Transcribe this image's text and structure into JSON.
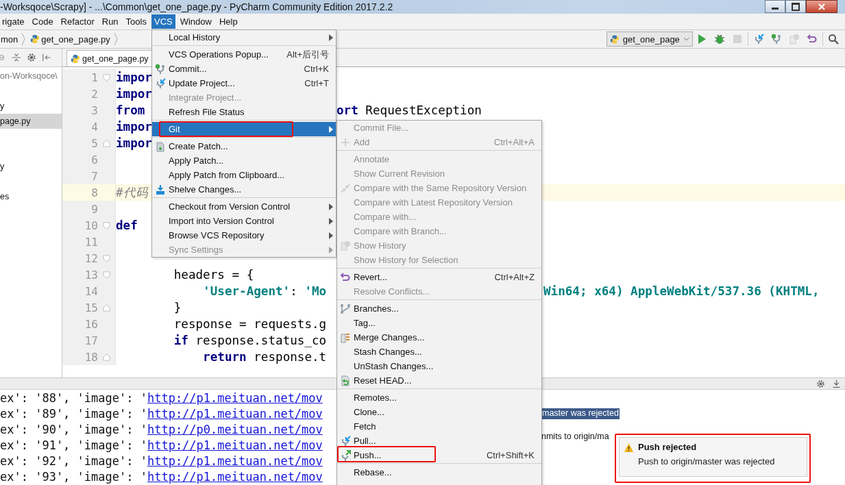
{
  "window": {
    "title": "-Worksqoce\\Scrapy] - ...\\Common\\get_one_page.py - PyCharm Community Edition 2017.2.2"
  },
  "menu_bar": [
    {
      "label": "rigate",
      "selected": false
    },
    {
      "label": "Code",
      "selected": false
    },
    {
      "label": "Refactor",
      "selected": false
    },
    {
      "label": "Run",
      "selected": false
    },
    {
      "label": "Tools",
      "selected": false
    },
    {
      "label": "VCS",
      "selected": true
    },
    {
      "label": "Window",
      "selected": false
    },
    {
      "label": "Help",
      "selected": false
    }
  ],
  "breadcrumb": [
    {
      "label": "mon",
      "kind": "folder"
    },
    {
      "label": "get_one_page.py",
      "kind": "file"
    }
  ],
  "run_config": {
    "label": "get_one_page"
  },
  "toolbar": [
    {
      "kind": "run",
      "disabled": false
    },
    {
      "kind": "debug",
      "disabled": false
    },
    {
      "kind": "stop",
      "disabled": true
    },
    {
      "kind": "vcs_update",
      "disabled": false
    },
    {
      "kind": "vcs_commit",
      "disabled": false
    },
    {
      "kind": "vcs_history",
      "disabled": true
    },
    {
      "kind": "revert",
      "disabled": false
    },
    {
      "kind": "search",
      "disabled": false
    }
  ],
  "project_panel": {
    "items": [
      {
        "label": "on-Worksqoce\\",
        "selected": false
      },
      {
        "label": "y",
        "selected": false
      },
      {
        "label": "page.py",
        "selected": true
      },
      {
        "label": "y",
        "selected": false
      },
      {
        "label": "es",
        "selected": false
      }
    ]
  },
  "editor": {
    "tabs": [
      {
        "label": "get_one_page.py",
        "selected": true
      }
    ],
    "lines": [
      {
        "number": "1",
        "current": false,
        "kind": "fold_start",
        "tokens": [
          {
            "kind": "kw",
            "text": "impor"
          }
        ]
      },
      {
        "number": "2",
        "current": false,
        "kind": "plain",
        "tokens": [
          {
            "kind": "kw",
            "text": "impor"
          }
        ]
      },
      {
        "number": "3",
        "current": false,
        "kind": "plain",
        "tokens": [
          {
            "kind": "kw",
            "text": "from"
          }
        ],
        "tail": {
          "kind": "right_of_menu",
          "tokens": [
            {
              "kind": "kw",
              "text": "ort"
            },
            {
              "kind": "plain",
              "text": " RequestException"
            }
          ]
        }
      },
      {
        "number": "4",
        "current": false,
        "kind": "plain",
        "tokens": [
          {
            "kind": "kw",
            "text": "impor"
          }
        ]
      },
      {
        "number": "5",
        "current": false,
        "kind": "fold_end",
        "tokens": [
          {
            "kind": "kw",
            "text": "impor"
          }
        ]
      },
      {
        "number": "6",
        "current": false,
        "kind": "plain"
      },
      {
        "number": "7",
        "current": false,
        "kind": "plain"
      },
      {
        "number": "8",
        "current": true,
        "kind": "plain",
        "tokens": [
          {
            "kind": "comment",
            "text": "#代码"
          }
        ]
      },
      {
        "number": "9",
        "current": false,
        "kind": "plain"
      },
      {
        "number": "10",
        "current": false,
        "kind": "fold_start",
        "tokens": [
          {
            "kind": "kw",
            "text": "def"
          }
        ]
      },
      {
        "number": "11",
        "current": false,
        "kind": "plain"
      },
      {
        "number": "12",
        "current": false,
        "kind": "fold_start"
      },
      {
        "number": "13",
        "current": false,
        "kind": "fold_start",
        "tokens": [
          {
            "kind": "plain",
            "text": "        headers = {"
          }
        ]
      },
      {
        "number": "14",
        "current": false,
        "kind": "plain",
        "tokens": [
          {
            "kind": "str",
            "text": "            'User-Agent'"
          },
          {
            "kind": "plain",
            "text": ": "
          },
          {
            "kind": "str",
            "text": "'Mo"
          }
        ],
        "tail": {
          "kind": "right_of_submenu",
          "tokens": [
            {
              "kind": "str",
              "text": "Win64; x64) AppleWebKit/537.36 (KHTML,"
            }
          ]
        }
      },
      {
        "number": "15",
        "current": false,
        "kind": "fold_end",
        "tokens": [
          {
            "kind": "plain",
            "text": "        }"
          }
        ]
      },
      {
        "number": "16",
        "current": false,
        "kind": "plain",
        "tokens": [
          {
            "kind": "plain",
            "text": "        response = requests.g"
          }
        ]
      },
      {
        "number": "17",
        "current": false,
        "kind": "plain",
        "tokens": [
          {
            "kind": "kw",
            "text": "        if"
          },
          {
            "kind": "plain",
            "text": " response.status_co"
          }
        ]
      },
      {
        "number": "18",
        "current": false,
        "kind": "fold_end",
        "tokens": [
          {
            "kind": "kw",
            "text": "            return"
          },
          {
            "kind": "plain",
            "text": " response.t"
          }
        ]
      }
    ]
  },
  "vcs_menu": {
    "items": [
      {
        "kind": "item",
        "label": "Local History",
        "submenu": true,
        "disabled": false,
        "selected": false
      },
      {
        "kind": "separator"
      },
      {
        "kind": "item",
        "label": "VCS Operations Popup...",
        "shortcut": "Alt+后引号",
        "submenu": false,
        "disabled": false,
        "selected": false
      },
      {
        "kind": "item",
        "label": "Commit...",
        "shortcut": "Ctrl+K",
        "submenu": false,
        "disabled": false,
        "selected": false
      },
      {
        "kind": "item",
        "label": "Update Project...",
        "shortcut": "Ctrl+T",
        "submenu": false,
        "disabled": false,
        "selected": false
      },
      {
        "kind": "item",
        "label": "Integrate Project...",
        "submenu": false,
        "disabled": true,
        "selected": false
      },
      {
        "kind": "item",
        "label": "Refresh File Status",
        "submenu": false,
        "disabled": false,
        "selected": false
      },
      {
        "kind": "separator"
      },
      {
        "kind": "item",
        "label": "Git",
        "submenu": true,
        "disabled": false,
        "selected": true,
        "highlighted": true
      },
      {
        "kind": "separator"
      },
      {
        "kind": "item",
        "label": "Create Patch...",
        "submenu": false,
        "disabled": false,
        "selected": false
      },
      {
        "kind": "item",
        "label": "Apply Patch...",
        "submenu": false,
        "disabled": false,
        "selected": false
      },
      {
        "kind": "item",
        "label": "Apply Patch from Clipboard...",
        "submenu": false,
        "disabled": false,
        "selected": false
      },
      {
        "kind": "item",
        "label": "Shelve Changes...",
        "submenu": false,
        "disabled": false,
        "selected": false
      },
      {
        "kind": "separator"
      },
      {
        "kind": "item",
        "label": "Checkout from Version Control",
        "submenu": true,
        "disabled": false,
        "selected": false
      },
      {
        "kind": "item",
        "label": "Import into Version Control",
        "submenu": true,
        "disabled": false,
        "selected": false
      },
      {
        "kind": "item",
        "label": "Browse VCS Repository",
        "submenu": true,
        "disabled": false,
        "selected": false
      },
      {
        "kind": "item",
        "label": "Sync Settings",
        "submenu": true,
        "disabled": true,
        "selected": false
      }
    ]
  },
  "git_menu": {
    "items": [
      {
        "kind": "item",
        "label": "Commit File...",
        "submenu": false,
        "disabled": true,
        "selected": false
      },
      {
        "kind": "item",
        "label": "Add",
        "shortcut": "Ctrl+Alt+A",
        "submenu": false,
        "disabled": true,
        "selected": false
      },
      {
        "kind": "separator"
      },
      {
        "kind": "item",
        "label": "Annotate",
        "submenu": false,
        "disabled": true,
        "selected": false
      },
      {
        "kind": "item",
        "label": "Show Current Revision",
        "submenu": false,
        "disabled": true,
        "selected": false
      },
      {
        "kind": "item",
        "label": "Compare with the Same Repository Version",
        "submenu": false,
        "disabled": true,
        "selected": false
      },
      {
        "kind": "item",
        "label": "Compare with Latest Repository Version",
        "submenu": false,
        "disabled": true,
        "selected": false
      },
      {
        "kind": "item",
        "label": "Compare with...",
        "submenu": false,
        "disabled": true,
        "selected": false
      },
      {
        "kind": "item",
        "label": "Compare with Branch...",
        "submenu": false,
        "disabled": true,
        "selected": false
      },
      {
        "kind": "item",
        "label": "Show History",
        "submenu": false,
        "disabled": true,
        "selected": false
      },
      {
        "kind": "item",
        "label": "Show History for Selection",
        "submenu": false,
        "disabled": true,
        "selected": false
      },
      {
        "kind": "separator"
      },
      {
        "kind": "item",
        "label": "Revert...",
        "shortcut": "Ctrl+Alt+Z",
        "submenu": false,
        "disabled": false,
        "selected": false
      },
      {
        "kind": "item",
        "label": "Resolve Conflicts...",
        "submenu": false,
        "disabled": true,
        "selected": false
      },
      {
        "kind": "separator"
      },
      {
        "kind": "item",
        "label": "Branches...",
        "submenu": false,
        "disabled": false,
        "selected": false
      },
      {
        "kind": "item",
        "label": "Tag...",
        "submenu": false,
        "disabled": false,
        "selected": false
      },
      {
        "kind": "item",
        "label": "Merge Changes...",
        "submenu": false,
        "disabled": false,
        "selected": false
      },
      {
        "kind": "item",
        "label": "Stash Changes...",
        "submenu": false,
        "disabled": false,
        "selected": false
      },
      {
        "kind": "item",
        "label": "UnStash Changes...",
        "submenu": false,
        "disabled": false,
        "selected": false
      },
      {
        "kind": "item",
        "label": "Reset HEAD...",
        "submenu": false,
        "disabled": false,
        "selected": false
      },
      {
        "kind": "separator"
      },
      {
        "kind": "item",
        "label": "Remotes...",
        "submenu": false,
        "disabled": false,
        "selected": false
      },
      {
        "kind": "item",
        "label": "Clone...",
        "submenu": false,
        "disabled": false,
        "selected": false
      },
      {
        "kind": "item",
        "label": "Fetch",
        "submenu": false,
        "disabled": false,
        "selected": false
      },
      {
        "kind": "item",
        "label": "Pull...",
        "submenu": false,
        "disabled": false,
        "selected": false
      },
      {
        "kind": "item",
        "label": "Push...",
        "shortcut": "Ctrl+Shift+K",
        "submenu": false,
        "disabled": false,
        "selected": false,
        "highlighted": true
      },
      {
        "kind": "separator"
      },
      {
        "kind": "item",
        "label": "Rebase...",
        "submenu": false,
        "disabled": false,
        "selected": false
      }
    ]
  },
  "console": {
    "lines": [
      {
        "text": "ex': '88', 'image': '",
        "link": "http://p1.meituan.net/mov"
      },
      {
        "text": "ex': '89', 'image': '",
        "link": "http://p1.meituan.net/mov"
      },
      {
        "text": "ex': '90', 'image': '",
        "link": "http://p0.meituan.net/mov"
      },
      {
        "text": "ex': '91', 'image': '",
        "link": "http://p1.meituan.net/mov"
      },
      {
        "text": "ex': '92', 'image': '",
        "link": "http://p1.meituan.net/mov"
      },
      {
        "text": "ex': '93', 'image': '",
        "link": "http://p1.meituan.net/mov"
      }
    ]
  },
  "event_log": {
    "lines": [
      {
        "text": "master was rejected",
        "selected": true
      },
      {
        "text": "nmits to origin/ma",
        "selected": false
      }
    ]
  },
  "notification": {
    "kind": "warning",
    "title": "Push rejected",
    "message": "Push to origin/master was rejected",
    "highlighted": true
  }
}
